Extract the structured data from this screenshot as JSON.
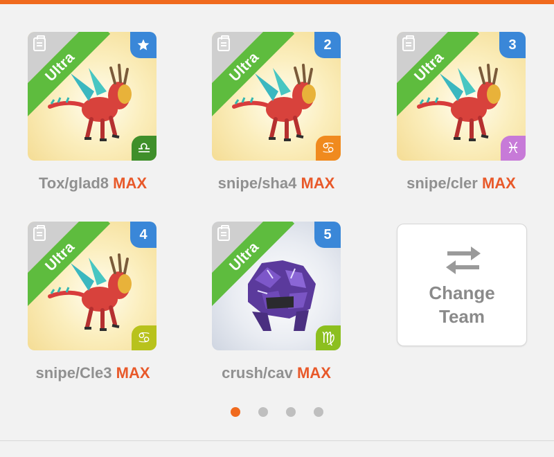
{
  "colors": {
    "accent_orange": "#f06a1e",
    "max_text": "#e8592a",
    "ribbon_green": "#5ebc3e",
    "badge_blue": "#3a87d8"
  },
  "team": [
    {
      "rarity": "Ultra",
      "slot": "",
      "slot_icon": "star-icon",
      "zodiac": "♎",
      "zodiac_name": "libra-icon",
      "zodiac_color": "#3f8f2a",
      "name": "Tox/glad8",
      "level": "MAX",
      "creature": "dragon"
    },
    {
      "rarity": "Ultra",
      "slot": "2",
      "slot_icon": "",
      "zodiac": "♋",
      "zodiac_name": "cancer-icon",
      "zodiac_color": "#f08a1e",
      "name": "snipe/sha4",
      "level": "MAX",
      "creature": "dragon"
    },
    {
      "rarity": "Ultra",
      "slot": "3",
      "slot_icon": "",
      "zodiac": "♓",
      "zodiac_name": "pisces-icon",
      "zodiac_color": "#c77ad8",
      "name": "snipe/cler",
      "level": "MAX",
      "creature": "dragon"
    },
    {
      "rarity": "Ultra",
      "slot": "4",
      "slot_icon": "",
      "zodiac": "♋",
      "zodiac_name": "cancer-icon",
      "zodiac_color": "#b8c21c",
      "name": "snipe/Cle3",
      "level": "MAX",
      "creature": "dragon"
    },
    {
      "rarity": "Ultra",
      "slot": "5",
      "slot_icon": "",
      "zodiac": "♍",
      "zodiac_name": "virgo-icon",
      "zodiac_color": "#8cbf1f",
      "name": "crush/cav",
      "level": "MAX",
      "creature": "golem"
    }
  ],
  "change_team": {
    "line1": "Change",
    "line2": "Team"
  },
  "pagination": {
    "pages": 4,
    "active": 1
  }
}
